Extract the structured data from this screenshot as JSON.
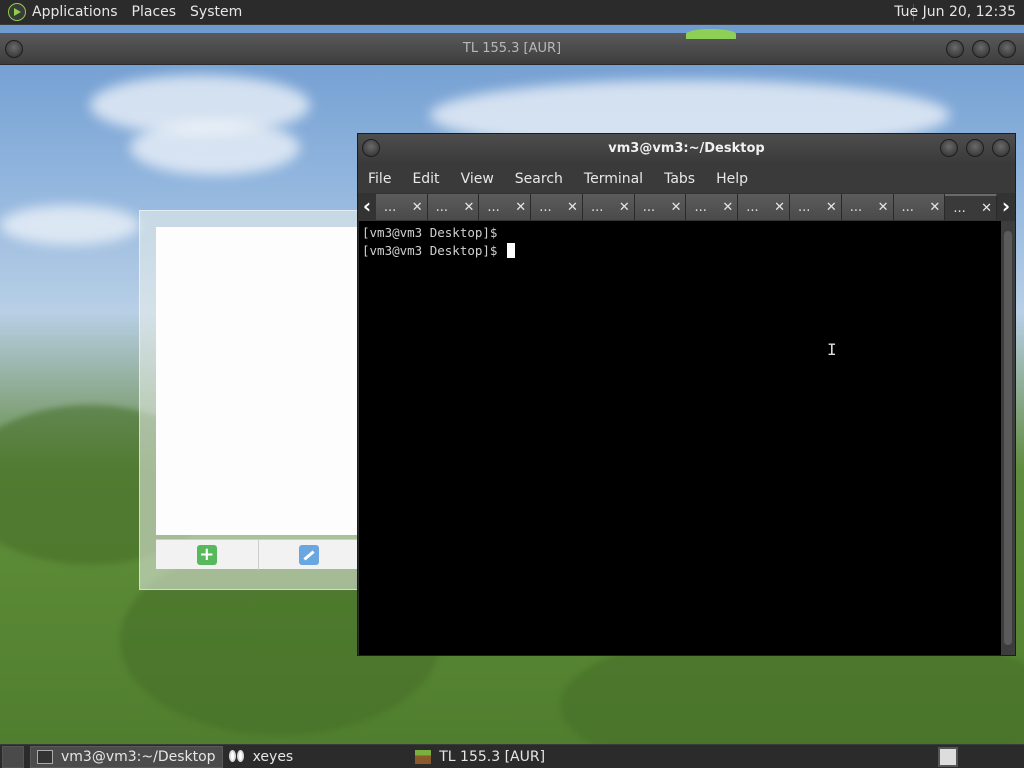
{
  "top_panel": {
    "menus": [
      "Applications",
      "Places",
      "System"
    ],
    "clock": "Tue Jun 20, 12:35"
  },
  "background_window": {
    "title": "TL 155.3 [AUR]"
  },
  "terminal": {
    "title": "vm3@vm3:~/Desktop",
    "menu": [
      "File",
      "Edit",
      "View",
      "Search",
      "Terminal",
      "Tabs",
      "Help"
    ],
    "tab_label": "...",
    "tab_count": 12,
    "lines": [
      "[vm3@vm3 Desktop]$",
      "[vm3@vm3 Desktop]$ "
    ]
  },
  "taskbar": {
    "tasks": [
      {
        "label": "vm3@vm3:~/Desktop",
        "icon": "terminal-icon"
      },
      {
        "label": "xeyes",
        "icon": "eyes-icon"
      },
      {
        "label": "TL 155.3 [AUR]",
        "icon": "grass-block-icon"
      }
    ]
  }
}
